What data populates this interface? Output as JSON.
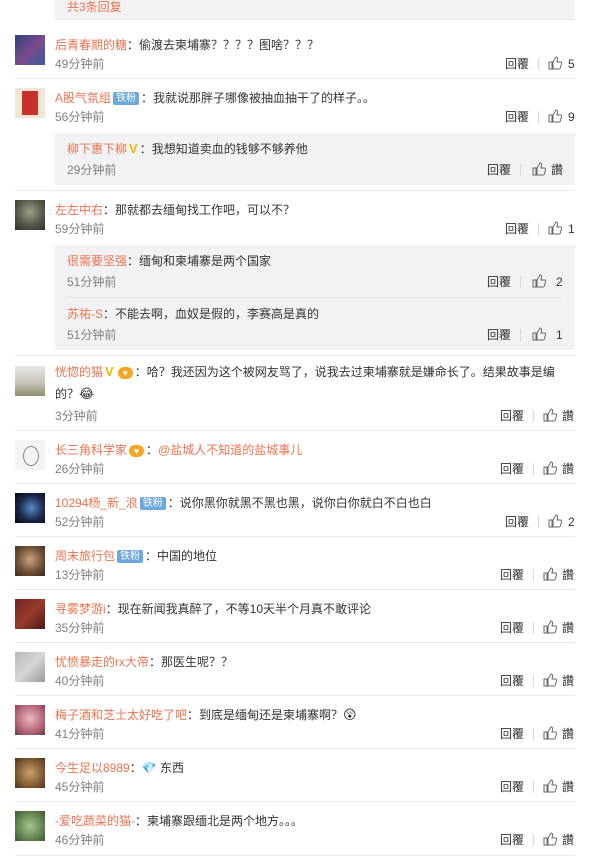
{
  "more_replies": "共3条回复",
  "actions": {
    "reply": "回覆",
    "like": "讚"
  },
  "comments": [
    {
      "name": "后青春期的糖",
      "text": "：偷渡去柬埔寨？？？？图啥？？？",
      "time": "49分钟前",
      "likes": "5"
    },
    {
      "name": "A股气氛组",
      "badge": "铁粉",
      "text": "：我就说那胖子哪像被抽血抽干了的样子。。",
      "time": "56分钟前",
      "likes": "9",
      "replies": [
        {
          "name": "柳下惠下柳",
          "text": "：我想知道卖血的钱够不够养他",
          "time": "29分钟前",
          "likes": "讚"
        }
      ]
    },
    {
      "name": "左左中右",
      "text": "：那就都去缅甸找工作吧，可以不？",
      "time": "59分钟前",
      "likes": "1",
      "replies": [
        {
          "name": "很需要坚强",
          "text": "：缅甸和柬埔寨是两个国家",
          "time": "51分钟前",
          "likes": "2"
        },
        {
          "name": "苏祐-S",
          "text": "：不能去啊，血奴是假的，李赛高是真的",
          "time": "51分钟前",
          "likes": "1"
        }
      ]
    },
    {
      "name": "恍惚的猫",
      "text": "：哈？我还因为这个被网友骂了，说我去过柬埔寨就是嫌命长了。结果故事是编的？",
      "emoji": "😂",
      "time": "3分钟前",
      "likes": "讚"
    },
    {
      "name": "长三角科学家",
      "mention": "@盐城人不知道的盐城事儿",
      "text": "：",
      "time": "26分钟前",
      "likes": "讚"
    },
    {
      "name": "10294杨_新_浪",
      "badge": "铁粉",
      "text": "：说你黑你就黑不黑也黑，说你白你就白不白也白",
      "time": "52分钟前",
      "likes": "2"
    },
    {
      "name": "周末旅行包",
      "badge": "铁粉",
      "text": "：中国的地位",
      "time": "13分钟前",
      "likes": "讚"
    },
    {
      "name": "寻雾梦游i",
      "text": "：现在新闻我真醉了，不等10天半个月真不敢评论",
      "time": "35分钟前",
      "likes": "讚"
    },
    {
      "name": "忧愤暴走的rx大帝",
      "text": "：那医生呢？？",
      "time": "40分钟前",
      "likes": "讚"
    },
    {
      "name": "梅子酒和芝士太好吃了吧",
      "text": "：到底是缅甸还是柬埔寨啊？",
      "emoji": "😲",
      "time": "41分钟前",
      "likes": "讚"
    },
    {
      "name": "今生足以8989",
      "text": "：💎 东西",
      "time": "45分钟前",
      "likes": "讚"
    },
    {
      "name": "-爱吃蔬菜的猫-",
      "text": "：柬埔寨跟缅北是两个地方。。。",
      "time": "46分钟前",
      "likes": "讚"
    }
  ]
}
